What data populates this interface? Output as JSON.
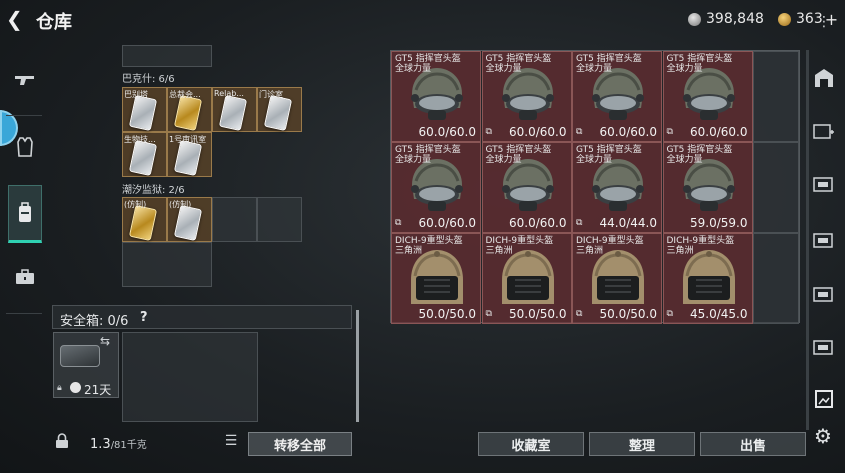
{
  "header": {
    "back_glyph": "❮",
    "title": "仓库",
    "currency1": {
      "icon": "silver-coin-icon",
      "value": "398,848"
    },
    "currency2": {
      "icon": "gold-coin-icon",
      "value": "363",
      "plus": "+"
    }
  },
  "left_nav": {
    "items": [
      {
        "name": "weapon-tab",
        "icon": "gun-icon"
      },
      {
        "name": "armor-tab",
        "icon": "vest-icon"
      },
      {
        "name": "backpack-tab",
        "icon": "backpack-icon",
        "active": true
      },
      {
        "name": "case-tab",
        "icon": "briefcase-icon"
      }
    ]
  },
  "left_panel": {
    "section1": {
      "label": "巴克什: 6/6",
      "items": [
        "巴别塔",
        "总裁会...",
        "Relab...",
        "门诊室",
        "生物技...",
        "1号审讯室"
      ]
    },
    "section2": {
      "label": "潮汐监狱: 2/6",
      "items": [
        "(仿制)",
        "(仿制)"
      ]
    },
    "safe": {
      "label": "安全箱: 0/6",
      "help": "?",
      "days": "21天"
    },
    "weight": {
      "value": "1.3",
      "unit": "/81千克"
    },
    "transfer_label": "转移全部"
  },
  "grid": {
    "rows": [
      [
        {
          "name": "GT5 指挥官头盔",
          "sub": "全球力量",
          "dur": "60.0/60.0",
          "bind": false
        },
        {
          "name": "GT5 指挥官头盔",
          "sub": "全球力量",
          "dur": "60.0/60.0",
          "bind": true
        },
        {
          "name": "GT5 指挥官头盔",
          "sub": "全球力量",
          "dur": "60.0/60.0",
          "bind": true
        },
        {
          "name": "GT5 指挥官头盔",
          "sub": "全球力量",
          "dur": "60.0/60.0",
          "bind": true
        }
      ],
      [
        {
          "name": "GT5 指挥官头盔",
          "sub": "全球力量",
          "dur": "60.0/60.0",
          "bind": true
        },
        {
          "name": "GT5 指挥官头盔",
          "sub": "全球力量",
          "dur": "60.0/60.0",
          "bind": false
        },
        {
          "name": "GT5 指挥官头盔",
          "sub": "全球力量",
          "dur": "44.0/44.0",
          "bind": true
        },
        {
          "name": "GT5 指挥官头盔",
          "sub": "全球力量",
          "dur": "59.0/59.0",
          "bind": false
        }
      ],
      [
        {
          "name": "DICH-9重型头盔",
          "sub": "三角洲",
          "dur": "50.0/50.0",
          "bind": false
        },
        {
          "name": "DICH-9重型头盔",
          "sub": "三角洲",
          "dur": "50.0/50.0",
          "bind": true
        },
        {
          "name": "DICH-9重型头盔",
          "sub": "三角洲",
          "dur": "50.0/50.0",
          "bind": true
        },
        {
          "name": "DICH-9重型头盔",
          "sub": "三角洲",
          "dur": "45.0/45.0",
          "bind": true
        }
      ]
    ]
  },
  "bottom_buttons": {
    "collection": "收藏室",
    "sort": "整理",
    "sell": "出售"
  }
}
